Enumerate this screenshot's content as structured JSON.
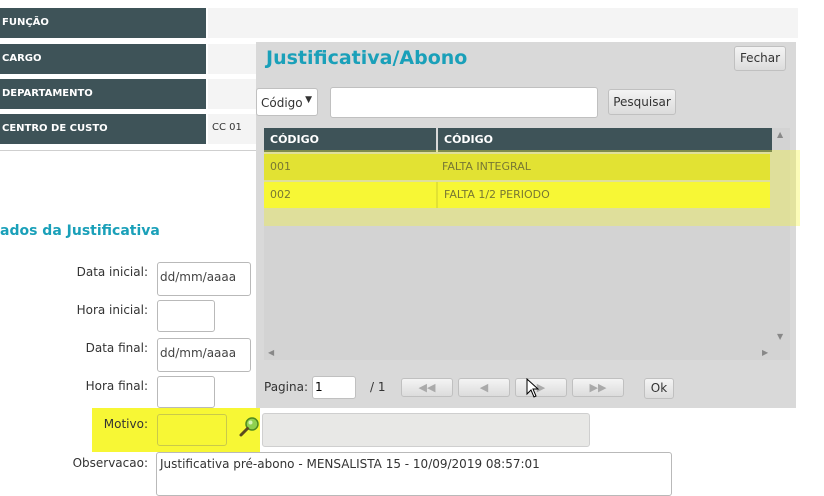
{
  "info": {
    "rows": [
      {
        "label": "FUNÇÃO",
        "value": ""
      },
      {
        "label": "CARGO",
        "value": ""
      },
      {
        "label": "DEPARTAMENTO",
        "value": ""
      },
      {
        "label": "CENTRO DE CUSTO",
        "value": "CC 01"
      }
    ]
  },
  "section": {
    "title": "ados da Justificativa"
  },
  "form": {
    "data_inicial": {
      "label": "Data inicial:",
      "placeholder": "dd/mm/aaaa"
    },
    "hora_inicial": {
      "label": "Hora inicial:",
      "value": ""
    },
    "data_final": {
      "label": "Data final:",
      "placeholder": "dd/mm/aaaa"
    },
    "hora_final": {
      "label": "Hora final:",
      "value": ""
    },
    "motivo": {
      "label": "Motivo:",
      "value": "",
      "description": ""
    },
    "observacao": {
      "label": "Observacao:",
      "value": "Justificativa pré-abono - MENSALISTA 15 - 10/09/2019 08:57:01"
    }
  },
  "modal": {
    "title": "Justificativa/Abono",
    "close_label": "Fechar",
    "filter_select": "Código",
    "search_value": "",
    "search_label": "Pesquisar",
    "columns": [
      "CÓDIGO",
      "CÓDIGO"
    ],
    "rows": [
      {
        "code": "001",
        "desc": "FALTA INTEGRAL"
      },
      {
        "code": "002",
        "desc": "FALTA 1/2 PERIODO"
      }
    ],
    "pager": {
      "page_label": "Pagina:",
      "page_value": "1",
      "total_label": "/ 1",
      "ok_label": "Ok"
    }
  },
  "colors": {
    "header_bg": "#3e5358",
    "accent": "#1aa0b9",
    "highlight": "#f7f735"
  }
}
